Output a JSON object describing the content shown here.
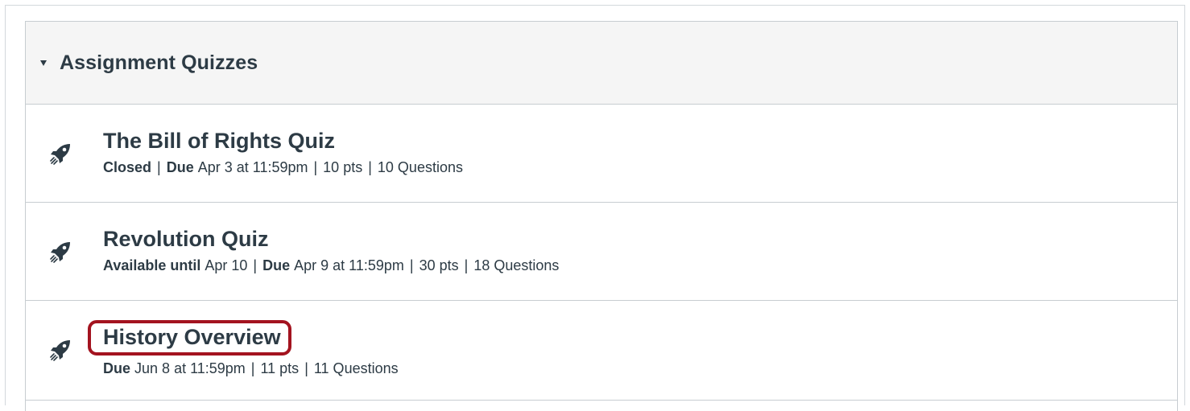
{
  "group": {
    "title": "Assignment Quizzes",
    "expanded": true
  },
  "quizzes": [
    {
      "title": "The Bill of Rights Quiz",
      "status_label": "Closed",
      "availability_date": "",
      "due_label": "Due",
      "due_date": "Apr 3 at 11:59pm",
      "points": "10 pts",
      "questions": "10 Questions",
      "icon": "rocket-icon"
    },
    {
      "title": "Revolution Quiz",
      "status_label": "Available until",
      "availability_date": "Apr 10",
      "due_label": "Due",
      "due_date": "Apr 9 at 11:59pm",
      "points": "30 pts",
      "questions": "18 Questions",
      "icon": "rocket-icon"
    },
    {
      "title": "History Overview",
      "status_label": "",
      "availability_date": "",
      "due_label": "Due",
      "due_date": "Jun 8 at 11:59pm",
      "points": "11 pts",
      "questions": "11 Questions",
      "icon": "rocket-icon",
      "highlighted": true
    }
  ],
  "colors": {
    "text": "#2d3b45",
    "header_bg": "#f5f5f5",
    "border": "#c7cdd1",
    "highlight": "#a3131f"
  }
}
